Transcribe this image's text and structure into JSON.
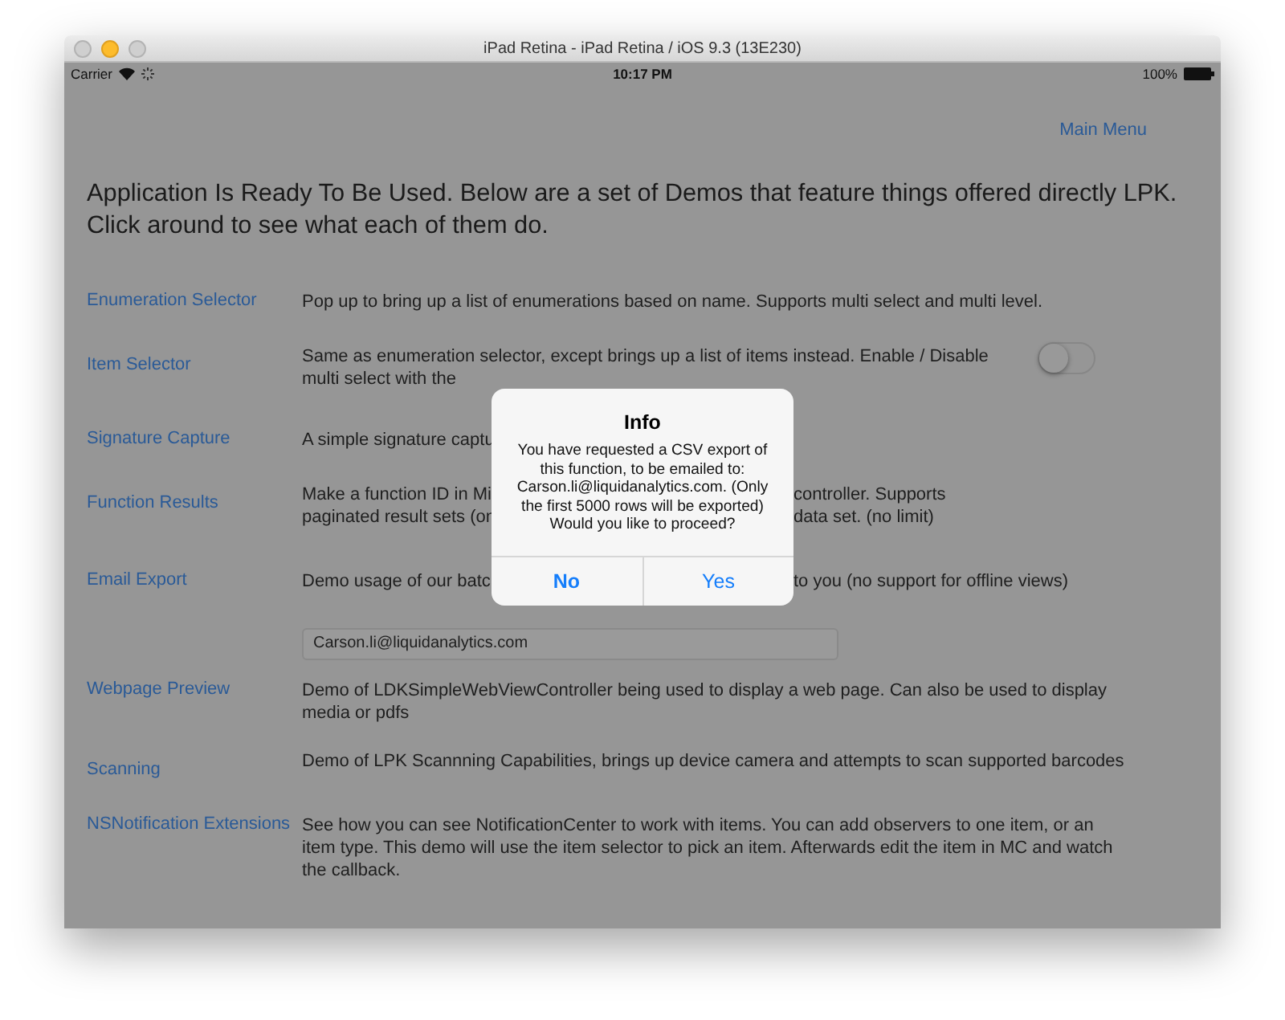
{
  "window": {
    "title": "iPad Retina - iPad Retina / iOS 9.3 (13E230)"
  },
  "status_bar": {
    "carrier": "Carrier",
    "time": "10:17 PM",
    "battery": "100%"
  },
  "nav": {
    "main_menu": "Main Menu"
  },
  "heading": "Application Is Ready To Be Used. Below are a set of Demos that feature things offered directly LPK. Click around to see what each of them do.",
  "demos": [
    {
      "label": "Enumeration Selector",
      "lines": [
        [
          "Pop up to bring up a list of enumerations based on name. Supports multi select and multi level."
        ]
      ]
    },
    {
      "label": "Item Selector",
      "lines": [
        [
          "Same as enumeration selector, except brings up a list of items instead. Enable / Disable"
        ],
        [
          "multi  select with the"
        ]
      ],
      "switch": {
        "on": false
      }
    },
    {
      "label": "Signature Capture",
      "lines": [
        [
          "A simple signature captu"
        ]
      ]
    },
    {
      "label": "Function Results",
      "lines": [
        [
          "Make a function ID in Mi",
          "controller.  Supports"
        ],
        [
          "paginated result sets (on",
          "data set. (no limit)"
        ]
      ]
    },
    {
      "label": "Email Export",
      "lines": [
        [
          "Demo usage of our batc",
          "to you (no support for offline views)"
        ]
      ],
      "field": {
        "value": "Carson.li@liquidanalytics.com"
      }
    },
    {
      "label": "Webpage Preview",
      "lines": [
        [
          "Demo of LDKSimpleWebViewController being used to display a web page. Can also be used to display"
        ],
        [
          "media or pdfs"
        ]
      ]
    },
    {
      "label": "Scanning",
      "lines": [
        [
          "Demo of LPK Scannning Capabilities, brings up device camera and attempts to scan supported barcodes"
        ]
      ]
    },
    {
      "label": "NSNotification Extensions",
      "lines": [
        [
          "See how you can see NotificationCenter to work with items.  You can add observers to one item, or an"
        ],
        [
          "item type. This demo will use the item selector to pick an item. Afterwards edit the item in MC and watch"
        ],
        [
          "the callback."
        ]
      ]
    }
  ],
  "alert": {
    "title": "Info",
    "message": "You have requested a CSV export of this function, to be emailed to: Carson.li@liquidanalytics.com. (Only the first 5000 rows will be exported) Would you like to proceed?",
    "buttons": [
      {
        "label": "No",
        "preferred": true
      },
      {
        "label": "Yes",
        "preferred": false
      }
    ]
  }
}
